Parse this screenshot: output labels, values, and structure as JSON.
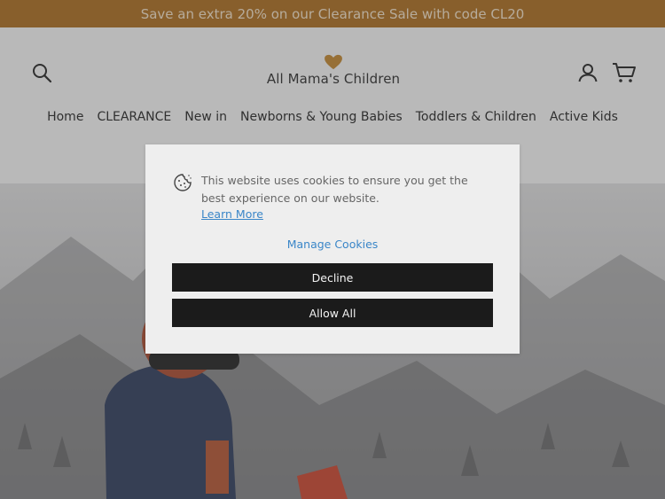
{
  "announcement": {
    "text": "Save an extra 20% on our Clearance Sale with code CL20"
  },
  "header": {
    "brand": "All Mama's Children",
    "icons": {
      "search": "search-icon",
      "account": "account-icon",
      "cart": "cart-icon",
      "logo": "heart-logo"
    }
  },
  "nav": {
    "items": [
      "Home",
      "CLEARANCE",
      "New in",
      "Newborns & Young Babies",
      "Toddlers & Children",
      "Active Kids"
    ]
  },
  "cookie_modal": {
    "message": "This website uses cookies to ensure you get the best experience on our website.",
    "learn_more": "Learn More",
    "manage": "Manage Cookies",
    "decline": "Decline",
    "allow": "Allow All",
    "icon": "cookie-icon"
  },
  "colors": {
    "announce_bg": "#b06f1c",
    "brand_heart": "#c98a2e",
    "link": "#3a86c8",
    "button": "#1b1b1b"
  }
}
